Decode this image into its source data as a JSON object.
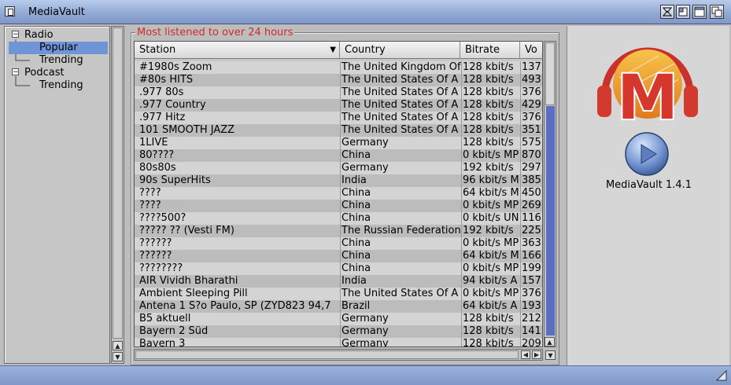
{
  "window": {
    "title": "MediaVault"
  },
  "tree": {
    "nodes": [
      {
        "label": "Radio",
        "expander": "−"
      },
      {
        "label": "Popular"
      },
      {
        "label": "Trending"
      },
      {
        "label": "Podcast",
        "expander": "−"
      },
      {
        "label": "Trending"
      }
    ]
  },
  "group": {
    "title": "Most listened to over 24 hours"
  },
  "table": {
    "columns": [
      "Station",
      "Country",
      "Bitrate",
      "Vo"
    ],
    "sort_indicator": "▼",
    "rows": [
      [
        "#1980s Zoom",
        "The United Kingdom Of",
        "128 kbit/s",
        "137"
      ],
      [
        "#80s HITS",
        "The United States Of A",
        "128 kbit/s",
        "493"
      ],
      [
        ".977 80s",
        "The United States Of A",
        "128 kbit/s",
        "376"
      ],
      [
        ".977 Country",
        "The United States Of A",
        "128 kbit/s",
        "429"
      ],
      [
        ".977 Hitz",
        "The United States Of A",
        "128 kbit/s",
        "376"
      ],
      [
        "101 SMOOTH JAZZ",
        "The United States Of A",
        "128 kbit/s",
        "351"
      ],
      [
        "1LIVE",
        "Germany",
        "128 kbit/s",
        "575"
      ],
      [
        "80????",
        "China",
        "0 kbit/s MP",
        "870"
      ],
      [
        "80s80s",
        "Germany",
        "192 kbit/s",
        "297"
      ],
      [
        "90s SuperHits",
        "India",
        "96 kbit/s M",
        "385"
      ],
      [
        "????",
        "China",
        "64 kbit/s M",
        "450"
      ],
      [
        "????",
        "China",
        "0 kbit/s MP",
        "269"
      ],
      [
        "????500?",
        "China",
        "0 kbit/s UN",
        "116"
      ],
      [
        "????? ?? (Vesti FM)",
        "The Russian Federation",
        "192 kbit/s",
        "225"
      ],
      [
        "??????",
        "China",
        "0 kbit/s MP",
        "363"
      ],
      [
        "??????",
        "China",
        "64 kbit/s M",
        "166"
      ],
      [
        "????????",
        "China",
        "0 kbit/s MP",
        "199"
      ],
      [
        "AIR Vividh Bharathi",
        "India",
        "94 kbit/s A",
        "157"
      ],
      [
        "Ambient Sleeping Pill",
        "The United States Of A",
        "0 kbit/s MP",
        "376"
      ],
      [
        "Antena 1 S?o Paulo, SP (ZYD823 94,7",
        "Brazil",
        "64 kbit/s A",
        "193"
      ],
      [
        "B5 aktuell",
        "Germany",
        "128 kbit/s",
        "212"
      ],
      [
        "Bayern 2 Süd",
        "Germany",
        "128 kbit/s",
        "141"
      ],
      [
        "Bayern 3",
        "Germany",
        "128 kbit/s",
        "209"
      ]
    ]
  },
  "about": {
    "logo_letter": "M",
    "version": "MediaVault 1.4.1"
  },
  "colors": {
    "accent": "#6f95d6",
    "group_title": "#d12a2a",
    "logo_red": "#d23a2e",
    "logo_orange": "#f0a020"
  }
}
